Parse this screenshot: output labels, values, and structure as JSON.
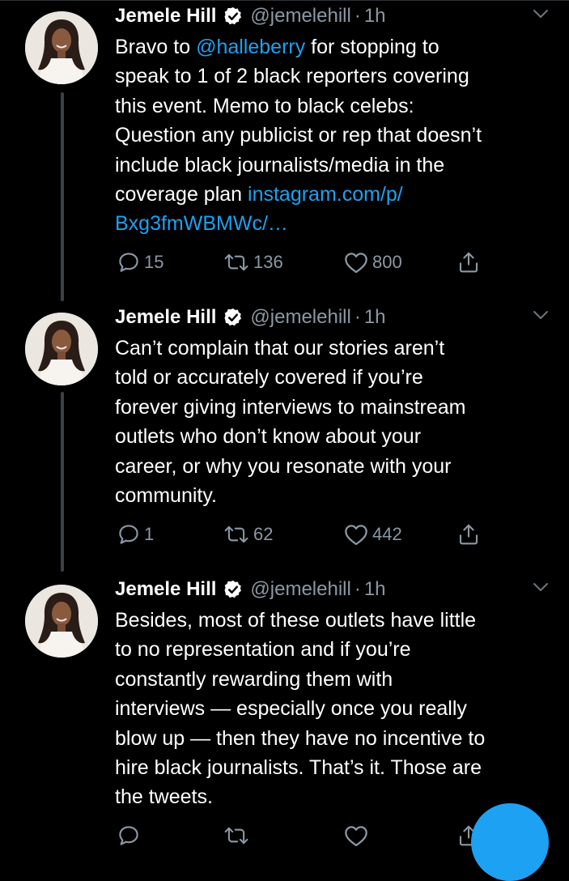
{
  "colors": {
    "background": "#000000",
    "primary_text": "#ffffff",
    "secondary_text": "#8b98a5",
    "link": "#1da1f2",
    "thread_line": "#3d4145",
    "compose_button": "#1da1f2"
  },
  "tweets": [
    {
      "author": {
        "name": "Jemele Hill",
        "handle": "@jemelehill",
        "verified": true
      },
      "separator": "·",
      "time": "1h",
      "text_lines": [
        [
          {
            "text": "Bravo to "
          },
          {
            "text": "@halleberry",
            "link": true
          },
          {
            "text": " for stopping to"
          }
        ],
        [
          {
            "text": "speak to 1 of 2 black reporters covering"
          }
        ],
        [
          {
            "text": "this event. Memo to black celebs:"
          }
        ],
        [
          {
            "text": "Question any publicist or rep that doesn’t"
          }
        ],
        [
          {
            "text": "include black journalists/media in the"
          }
        ],
        [
          {
            "text": "coverage plan "
          },
          {
            "text": "instagram.com/p/",
            "link": true
          }
        ],
        [
          {
            "text": "Bxg3fmWBMWc/…",
            "link": true
          }
        ]
      ],
      "stats": {
        "replies": "15",
        "retweets": "136",
        "likes": "800"
      },
      "icons": [
        "reply-icon",
        "retweet-icon",
        "like-icon",
        "share-icon",
        "chevron-down-icon",
        "verified-badge-icon"
      ]
    },
    {
      "author": {
        "name": "Jemele Hill",
        "handle": "@jemelehill",
        "verified": true
      },
      "separator": "·",
      "time": "1h",
      "text_lines": [
        [
          {
            "text": "Can’t complain that our stories aren’t"
          }
        ],
        [
          {
            "text": "told or accurately covered if you’re"
          }
        ],
        [
          {
            "text": "forever giving interviews to mainstream"
          }
        ],
        [
          {
            "text": "outlets who don’t know about your"
          }
        ],
        [
          {
            "text": "career, or why you resonate with your"
          }
        ],
        [
          {
            "text": "community."
          }
        ]
      ],
      "stats": {
        "replies": "1",
        "retweets": "62",
        "likes": "442"
      },
      "icons": [
        "reply-icon",
        "retweet-icon",
        "like-icon",
        "share-icon",
        "chevron-down-icon",
        "verified-badge-icon"
      ]
    },
    {
      "author": {
        "name": "Jemele Hill",
        "handle": "@jemelehill",
        "verified": true
      },
      "separator": "·",
      "time": "1h",
      "text_lines": [
        [
          {
            "text": "Besides, most of these outlets have little"
          }
        ],
        [
          {
            "text": "to no representation and if you’re"
          }
        ],
        [
          {
            "text": "constantly rewarding them with"
          }
        ],
        [
          {
            "text": "interviews — especially once you really"
          }
        ],
        [
          {
            "text": "blow up — then they have no incentive to"
          }
        ],
        [
          {
            "text": "hire black journalists. That’s it. Those are"
          }
        ],
        [
          {
            "text": "the tweets."
          }
        ]
      ],
      "stats": {
        "replies": "",
        "retweets": "",
        "likes": ""
      },
      "icons": [
        "reply-icon",
        "retweet-icon",
        "like-icon",
        "share-icon",
        "chevron-down-icon",
        "verified-badge-icon"
      ]
    }
  ],
  "compose_button": {
    "icon": "compose-icon"
  }
}
